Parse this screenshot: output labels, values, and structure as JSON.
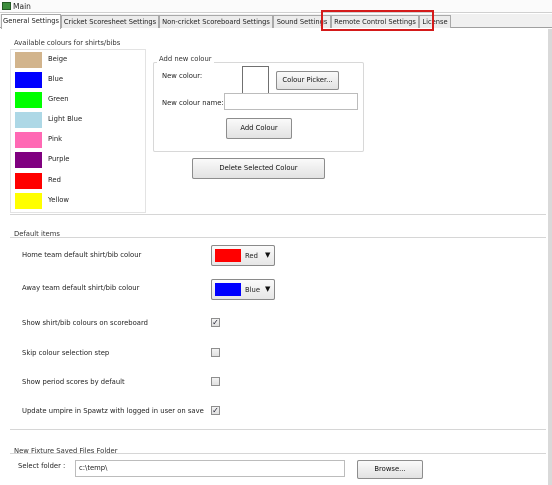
{
  "window": {
    "title": "Main"
  },
  "tabs": [
    {
      "label": "General Settings"
    },
    {
      "label": "Cricket Scoresheet Settings"
    },
    {
      "label": "Non-cricket Scoreboard Settings"
    },
    {
      "label": "Sound Settings"
    },
    {
      "label": "Remote Control Settings"
    },
    {
      "label": "License"
    }
  ],
  "colours": {
    "group_label": "Available colours for shirts/bibs",
    "items": [
      {
        "name": "Beige",
        "color": "#d2b48c"
      },
      {
        "name": "Blue",
        "color": "#0000ff"
      },
      {
        "name": "Green",
        "color": "#00ff00"
      },
      {
        "name": "Light Blue",
        "color": "#add8e6"
      },
      {
        "name": "Pink",
        "color": "#ff69b4"
      },
      {
        "name": "Purple",
        "color": "#800080"
      },
      {
        "name": "Red",
        "color": "#ff0000"
      },
      {
        "name": "Yellow",
        "color": "#ffff00"
      }
    ]
  },
  "add_colour": {
    "group_label": "Add new colour",
    "new_colour_label": "New colour:",
    "picker_button": "Colour Picker...",
    "name_label": "New colour name:",
    "name_value": "",
    "add_button": "Add Colour"
  },
  "delete_button": "Delete Selected Colour",
  "defaults": {
    "group_label": "Default items",
    "home_label": "Home team default shirt/bib colour",
    "home_value": "Red",
    "home_color": "#ff0000",
    "away_label": "Away team default shirt/bib colour",
    "away_value": "Blue",
    "away_color": "#0000ff",
    "options": [
      {
        "label": "Show shirt/bib colours on scoreboard",
        "checked": true,
        "mark": "✓"
      },
      {
        "label": "Skip colour selection step",
        "checked": false,
        "mark": ""
      },
      {
        "label": "Show period scores by default",
        "checked": false,
        "mark": ""
      },
      {
        "label": "Update umpire in Spawtz with logged in user on save",
        "checked": true,
        "mark": "✓"
      }
    ]
  },
  "fixture_folder": {
    "group_label": "New Fixture Saved Files Folder",
    "select_label": "Select folder :",
    "path": "c:\\temp\\",
    "browse_button": "Browse..."
  },
  "accent": {
    "highlight": "#d41a1a"
  }
}
